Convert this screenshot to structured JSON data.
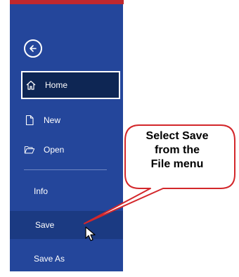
{
  "nav": {
    "home": "Home",
    "new": "New",
    "open": "Open",
    "info": "Info",
    "save": "Save",
    "save_as": "Save As"
  },
  "callout": {
    "line1": "Select Save",
    "line2": "from the",
    "line3": "File menu"
  },
  "icons": {
    "back": "back-arrow-icon",
    "home": "home-icon",
    "new": "new-document-icon",
    "open": "open-folder-icon",
    "cursor": "mouse-pointer-icon"
  },
  "colors": {
    "sidebar": "#24469b",
    "selected": "#0e2654",
    "hover": "#1b3a82",
    "accent_bar": "#c0282d",
    "callout_fill": "#ffffff",
    "callout_border": "#d3272b"
  }
}
